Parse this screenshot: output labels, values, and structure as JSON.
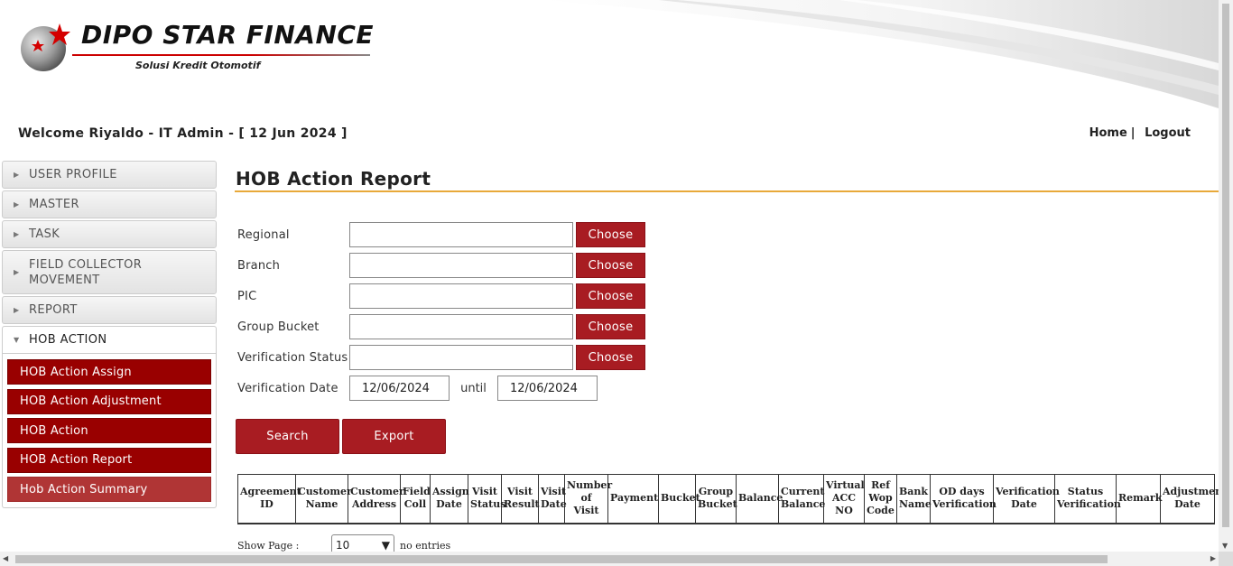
{
  "brand": {
    "name": "DIPO STAR FINANCE",
    "tagline": "Solusi Kredit Otomotif"
  },
  "header": {
    "welcome": "Welcome Riyaldo - IT Admin - [ 12 Jun 2024 ]",
    "home_link": "Home",
    "separator": "|",
    "logout_link": "Logout"
  },
  "sidebar": {
    "items": [
      {
        "label": "USER PROFILE"
      },
      {
        "label": "MASTER"
      },
      {
        "label": "TASK"
      },
      {
        "label": "FIELD COLLECTOR MOVEMENT"
      },
      {
        "label": "REPORT"
      },
      {
        "label": "HOB ACTION"
      }
    ],
    "submenu": [
      {
        "label": "HOB Action Assign"
      },
      {
        "label": "HOB Action Adjustment"
      },
      {
        "label": "HOB Action"
      },
      {
        "label": "HOB Action Report"
      },
      {
        "label": "Hob Action Summary"
      }
    ]
  },
  "main": {
    "title": "HOB Action Report",
    "form": {
      "regional_label": "Regional",
      "branch_label": "Branch",
      "pic_label": "PIC",
      "group_bucket_label": "Group Bucket",
      "verification_status_label": "Verification Status",
      "verification_date_label": "Verification Date",
      "choose_label": "Choose",
      "date_from": "12/06/2024",
      "until_label": "until",
      "date_to": "12/06/2024"
    },
    "search_label": "Search",
    "export_label": "Export",
    "table_headers": [
      "Agreement ID",
      "Customer Name",
      "Customer Address",
      "Field Coll",
      "Assign Date",
      "Visit Status",
      "Visit Result",
      "Visit Date",
      "Number of Visit",
      "Payment",
      "Bucket",
      "Group Bucket",
      "Balance",
      "Current Balance",
      "Virtual ACC NO",
      "Ref Wop Code",
      "Bank Name",
      "OD days Verification",
      "Verification Date",
      "Status Verification",
      "Remark",
      "Adjustment Date"
    ],
    "show_page_label": "Show Page :",
    "page_size": "10",
    "entries_text": "no entries"
  },
  "colors": {
    "accent_red": "#a81c22",
    "submenu_red": "#990000",
    "title_underline": "#e8a93a"
  }
}
